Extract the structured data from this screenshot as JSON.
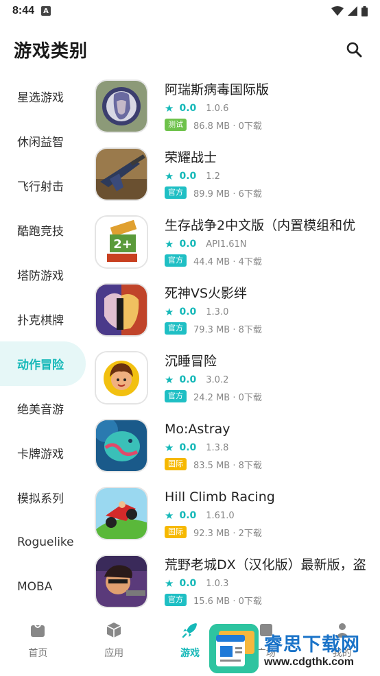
{
  "status_bar": {
    "time": "8:44",
    "notification_badge": "A"
  },
  "header": {
    "title": "游戏类别"
  },
  "sidebar": {
    "active_index": 6,
    "items": [
      {
        "label": "星选游戏"
      },
      {
        "label": "休闲益智"
      },
      {
        "label": "飞行射击"
      },
      {
        "label": "酷跑竞技"
      },
      {
        "label": "塔防游戏"
      },
      {
        "label": "扑克棋牌"
      },
      {
        "label": "动作冒险"
      },
      {
        "label": "绝美音游"
      },
      {
        "label": "卡牌游戏"
      },
      {
        "label": "模拟系列"
      },
      {
        "label": "Roguelike"
      },
      {
        "label": "MOBA"
      }
    ]
  },
  "apps": [
    {
      "name": "阿瑞斯病毒国际版",
      "rating": "0.0",
      "version": "1.0.6",
      "badge": "测试",
      "badge_color": "#6ec24b",
      "size_downloads": "86.8 MB · 0下载"
    },
    {
      "name": "荣耀战士",
      "rating": "0.0",
      "version": "1.2",
      "badge": "官方",
      "badge_color": "#1fbfc4",
      "size_downloads": "89.9 MB · 6下载"
    },
    {
      "name": "生存战争2中文版（内置模组和优",
      "rating": "0.0",
      "version": "API1.61N",
      "badge": "官方",
      "badge_color": "#1fbfc4",
      "size_downloads": "44.4 MB · 4下载"
    },
    {
      "name": "死神VS火影绊",
      "rating": "0.0",
      "version": "1.3.0",
      "badge": "官方",
      "badge_color": "#1fbfc4",
      "size_downloads": "79.3 MB · 8下载"
    },
    {
      "name": "沉睡冒险",
      "rating": "0.0",
      "version": "3.0.2",
      "badge": "官方",
      "badge_color": "#1fbfc4",
      "size_downloads": "24.2 MB · 0下载"
    },
    {
      "name": "Mo:Astray",
      "rating": "0.0",
      "version": "1.3.8",
      "badge": "国际",
      "badge_color": "#f6b800",
      "size_downloads": "83.5 MB · 8下载"
    },
    {
      "name": "Hill Climb Racing",
      "rating": "0.0",
      "version": "1.61.0",
      "badge": "国际",
      "badge_color": "#f6b800",
      "size_downloads": "92.3 MB · 2下载"
    },
    {
      "name": "荒野老城DX（汉化版）最新版，盗",
      "rating": "0.0",
      "version": "1.0.3",
      "badge": "官方",
      "badge_color": "#1fbfc4",
      "size_downloads": "15.6 MB · 0下载"
    }
  ],
  "bottom_nav": {
    "active_index": 2,
    "items": [
      {
        "label": "首页",
        "icon": "home-bag-icon"
      },
      {
        "label": "应用",
        "icon": "cube-icon"
      },
      {
        "label": "游戏",
        "icon": "rocket-icon"
      },
      {
        "label": "广场",
        "icon": "square-icon"
      },
      {
        "label": "我的",
        "icon": "person-icon"
      }
    ]
  },
  "watermark": {
    "cn_text": "睿思下载网",
    "url": "www.cdgthk.com"
  },
  "colors": {
    "accent": "#15b8b8",
    "accent_bg": "#e6f7f7",
    "badge_test": "#6ec24b",
    "badge_official": "#1fbfc4",
    "badge_intl": "#f6b800"
  }
}
